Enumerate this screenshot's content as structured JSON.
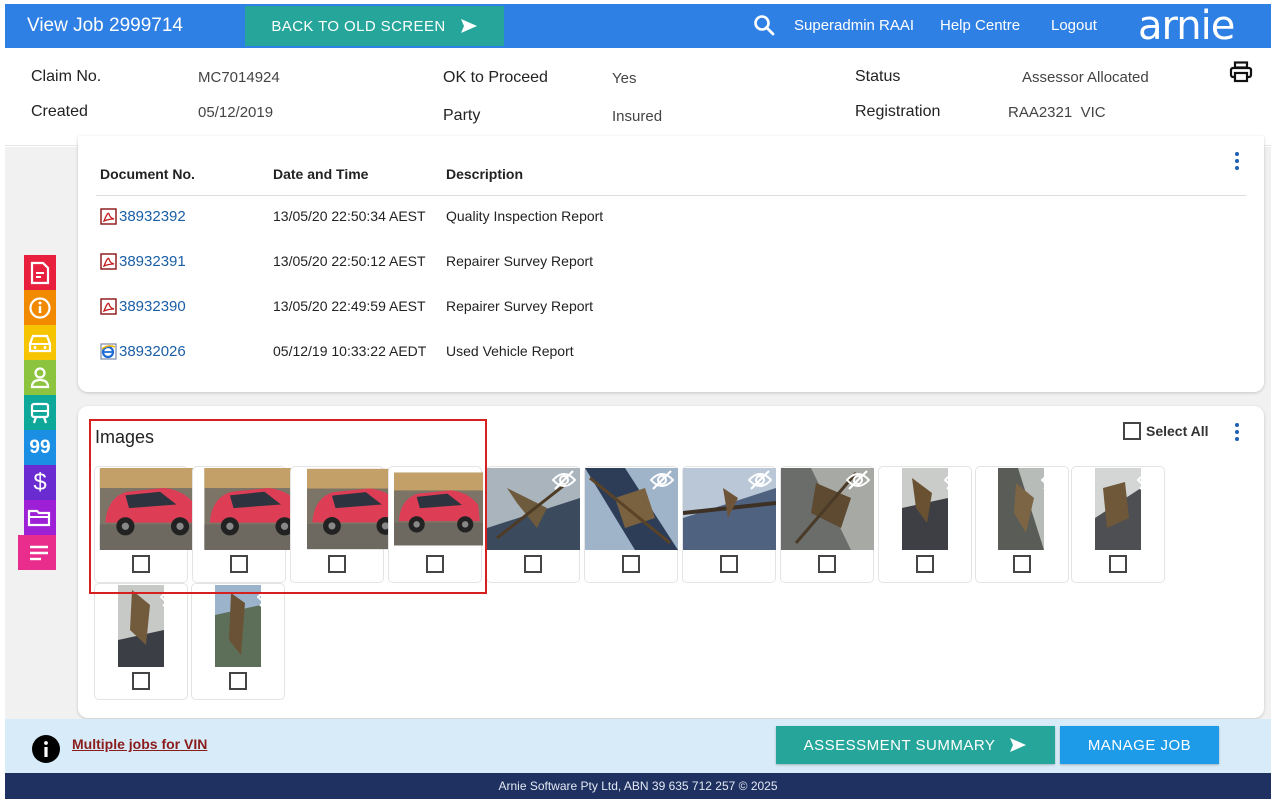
{
  "header": {
    "title": "View Job 2999714",
    "back_button": "BACK TO OLD SCREEN",
    "user": "Superadmin RAAI",
    "help": "Help Centre",
    "logout": "Logout",
    "logo": "arnie"
  },
  "claim": {
    "claim_no_label": "Claim No.",
    "claim_no": "MC7014924",
    "created_label": "Created",
    "created": "05/12/2019",
    "ok_label": "OK to Proceed",
    "ok": "Yes",
    "party_label": "Party",
    "party": "Insured",
    "status_label": "Status",
    "status": "Assessor Allocated",
    "registration_label": "Registration",
    "registration": "RAA2321",
    "state": "VIC"
  },
  "sidebar": {
    "colors": [
      "#e8203e",
      "#f28a00",
      "#f6c400",
      "#8cc43f",
      "#0ea89a",
      "#1a8fe3",
      "#6a2bd0",
      "#9d1fd6",
      "#e92d8c"
    ],
    "items": [
      {
        "icon": "document-icon"
      },
      {
        "icon": "info-icon"
      },
      {
        "icon": "car-icon"
      },
      {
        "icon": "person-icon"
      },
      {
        "icon": "tow-icon"
      },
      {
        "icon": "quote-icon",
        "text": "99"
      },
      {
        "icon": "dollar-icon",
        "text": "$"
      },
      {
        "icon": "folder-icon"
      },
      {
        "icon": "list-icon"
      }
    ]
  },
  "documents": {
    "columns": [
      "Document No.",
      "Date and Time",
      "Description"
    ],
    "rows": [
      {
        "icon": "pdf-icon",
        "number": "38932392",
        "date": "13/05/20 22:50:34 AEST",
        "description": "Quality Inspection Report"
      },
      {
        "icon": "pdf-icon",
        "number": "38932391",
        "date": "13/05/20 22:50:12 AEST",
        "description": "Repairer Survey Report"
      },
      {
        "icon": "pdf-icon",
        "number": "38932390",
        "date": "13/05/20 22:49:59 AEST",
        "description": "Repairer Survey Report"
      },
      {
        "icon": "ie-document-icon",
        "number": "38932026",
        "date": "05/12/19 10:33:22 AEDT",
        "description": "Used Vehicle Report"
      }
    ]
  },
  "images": {
    "title": "Images",
    "select_all": "Select All",
    "tiles": [
      {
        "type": "red-car",
        "hidden": false
      },
      {
        "type": "red-car",
        "hidden": false
      },
      {
        "type": "red-car",
        "hidden": false
      },
      {
        "type": "red-car",
        "hidden": false
      },
      {
        "type": "part-wide-a",
        "hidden": true
      },
      {
        "type": "part-wide-b",
        "hidden": true
      },
      {
        "type": "part-wide-c",
        "hidden": true
      },
      {
        "type": "part-wide-d",
        "hidden": true
      },
      {
        "type": "part-narrow-a",
        "hidden": true
      },
      {
        "type": "part-narrow-b",
        "hidden": true
      },
      {
        "type": "part-narrow-c",
        "hidden": true
      },
      {
        "type": "part-narrow-d",
        "hidden": true
      },
      {
        "type": "part-narrow-e",
        "hidden": true
      }
    ]
  },
  "footer": {
    "vin_link": "Multiple jobs for VIN",
    "assessment_summary": "ASSESSMENT SUMMARY",
    "manage_job": "MANAGE JOB",
    "copyright": "Arnie Software Pty Ltd, ABN 39 635 712 257 © 2025"
  }
}
